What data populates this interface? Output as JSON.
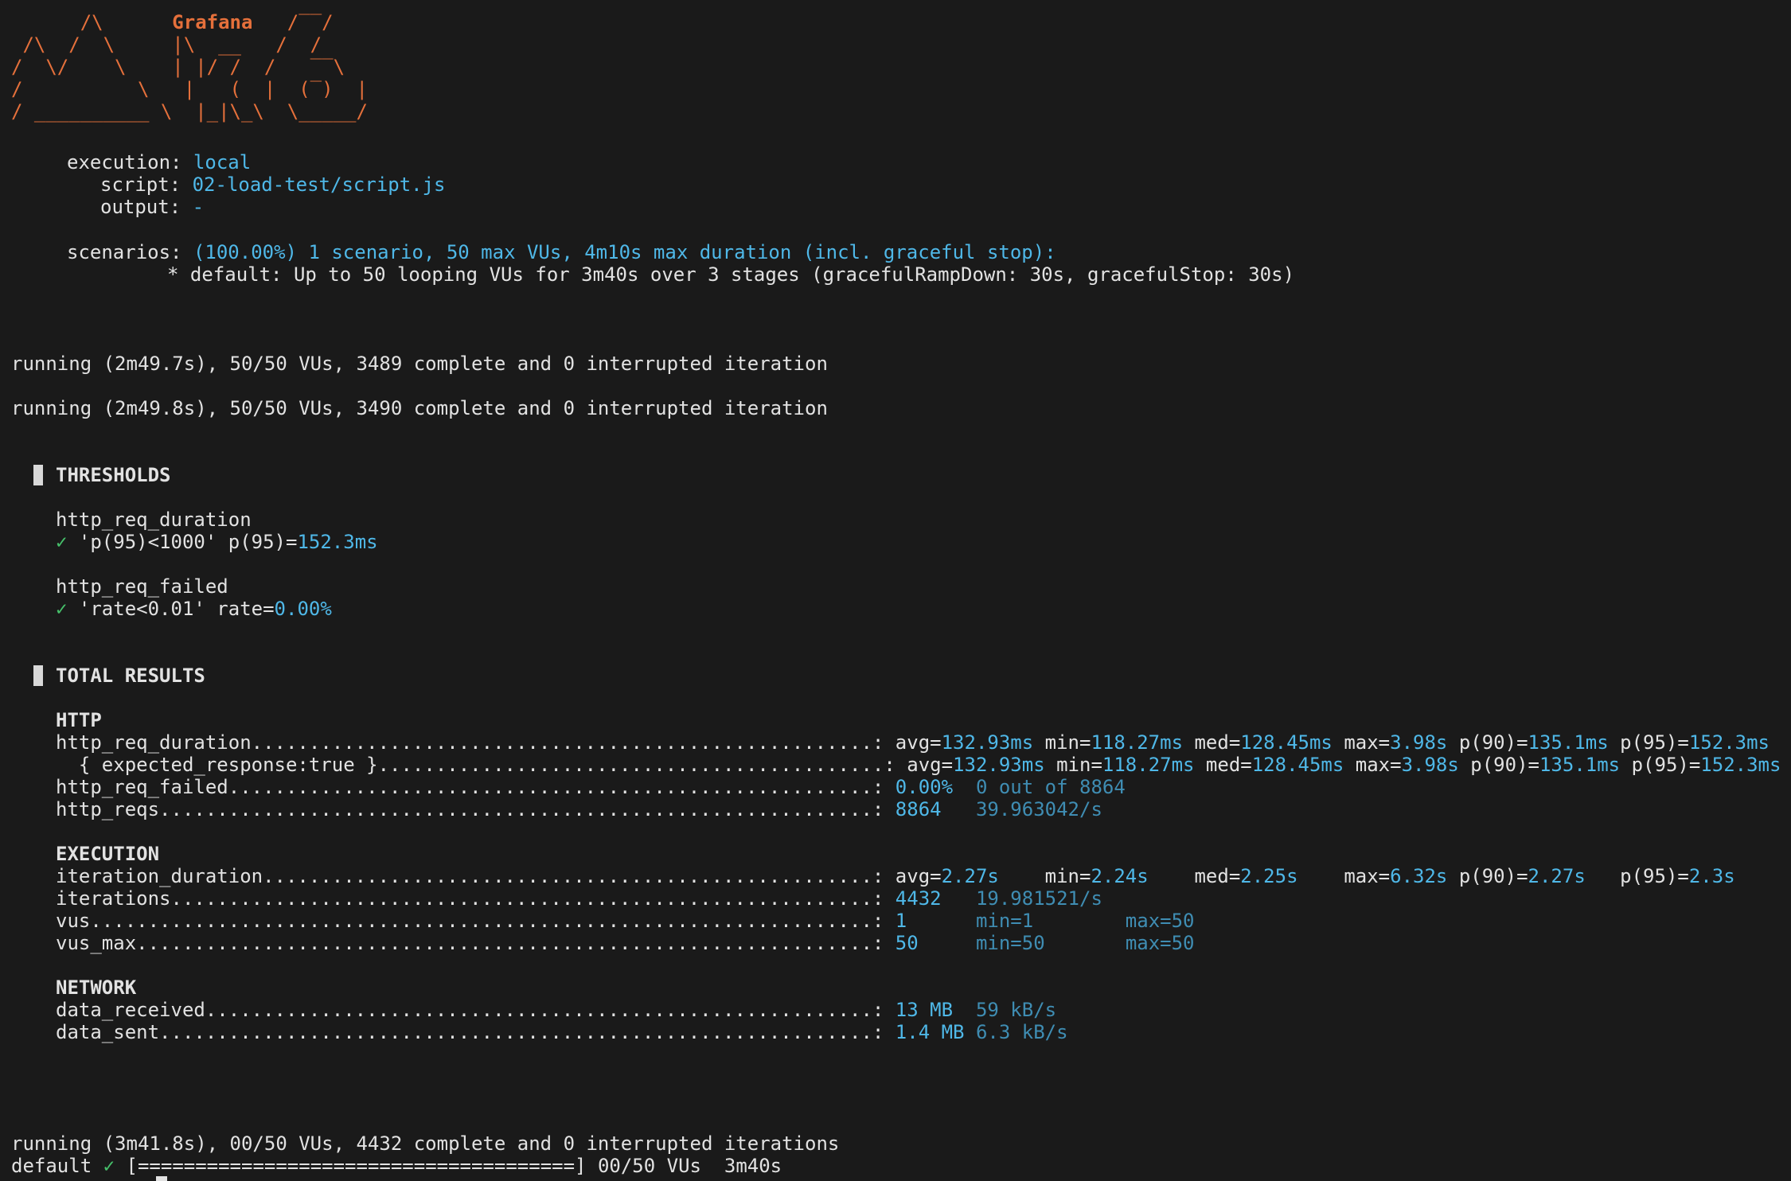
{
  "logo": {
    "brand": "Grafana",
    "art": "      /\\      Grafana   /‾‾/  \n /\\  /  \\     |\\  __   /  /   \n/  \\/    \\    | |/ /  /   ‾‾\\ \n/          \\   |   (  |  (‾)  |\n/ __________ \\  |_|\\_\\  \\_____/ "
  },
  "info": {
    "execution_label": "execution:",
    "execution_value": "local",
    "script_label": "script:",
    "script_value": "02-load-test/script.js",
    "output_label": "output:",
    "output_value": "-",
    "scenarios_label": "scenarios:",
    "scenarios_value": "(100.00%) 1 scenario, 50 max VUs, 4m10s max duration (incl. graceful stop):",
    "scenario_detail": "* default: Up to 50 looping VUs for 3m40s over 3 stages (gracefulRampDown: 30s, gracefulStop: 30s)"
  },
  "progress_lines": [
    "running (2m49.7s), 50/50 VUs, 3489 complete and 0 interrupted iteration",
    "running (2m49.8s), 50/50 VUs, 3490 complete and 0 interrupted iteration"
  ],
  "thresholds": {
    "header": "THRESHOLDS",
    "items": [
      {
        "metric": "http_req_duration",
        "check": "✓",
        "rule": "'p(95)<1000' p(95)=",
        "value": "152.3ms"
      },
      {
        "metric": "http_req_failed",
        "check": "✓",
        "rule": "'rate<0.01' rate=",
        "value": "0.00%"
      }
    ]
  },
  "results": {
    "header": "TOTAL RESULTS",
    "http_header": "HTTP",
    "http_rows": [
      {
        "name": "http_req_duration......................................................:",
        "avg_l": "avg=",
        "avg": "132.93ms",
        "min_l": " min=",
        "min": "118.27ms",
        "med_l": " med=",
        "med": "128.45ms",
        "max_l": " max=",
        "max": "3.98s",
        "p90_l": " p(90)=",
        "p90": "135.1ms",
        "p95_l": " p(95)=",
        "p95": "152.3ms"
      },
      {
        "name": "  { expected_response:true }............................................:",
        "avg_l": "avg=",
        "avg": "132.93ms",
        "min_l": " min=",
        "min": "118.27ms",
        "med_l": " med=",
        "med": "128.45ms",
        "max_l": " max=",
        "max": "3.98s",
        "p90_l": " p(90)=",
        "p90": "135.1ms",
        "p95_l": " p(95)=",
        "p95": "152.3ms"
      }
    ],
    "req_failed": {
      "name": "http_req_failed........................................................:",
      "value": "0.00%",
      "extra": "0 out of 8864"
    },
    "reqs": {
      "name": "http_reqs..............................................................:",
      "value": "8864",
      "extra": "39.963042/s"
    },
    "execution_header": "EXECUTION",
    "iteration_duration": {
      "name": "iteration_duration.....................................................:",
      "avg_l": "avg=",
      "avg": "2.27s",
      "min_l": "min=",
      "min": "2.24s",
      "med_l": "med=",
      "med": "2.25s",
      "max_l": "max=",
      "max": "6.32s",
      "p90_l": " p(90)=",
      "p90": "2.27s",
      "p95_l": "p(95)=",
      "p95": "2.3s"
    },
    "iterations": {
      "name": "iterations.............................................................:",
      "value": "4432",
      "extra": "19.981521/s"
    },
    "vus": {
      "name": "vus....................................................................:",
      "value": "1",
      "min": "min=1",
      "max": "max=50"
    },
    "vus_max": {
      "name": "vus_max................................................................:",
      "value": "50",
      "min": "min=50",
      "max": "max=50"
    },
    "network_header": "NETWORK",
    "data_received": {
      "name": "data_received..........................................................:",
      "value": "13 MB",
      "extra": "59 kB/s"
    },
    "data_sent": {
      "name": "data_sent..............................................................:",
      "value": "1.4 MB",
      "extra": "6.3 kB/s"
    }
  },
  "footer": {
    "final_line": "running (3m41.8s), 00/50 VUs, 4432 complete and 0 interrupted iterations",
    "default_label": "default",
    "check": "✓",
    "bar": "[======================================]",
    "bar_status": "00/50 VUs  3m40s"
  }
}
